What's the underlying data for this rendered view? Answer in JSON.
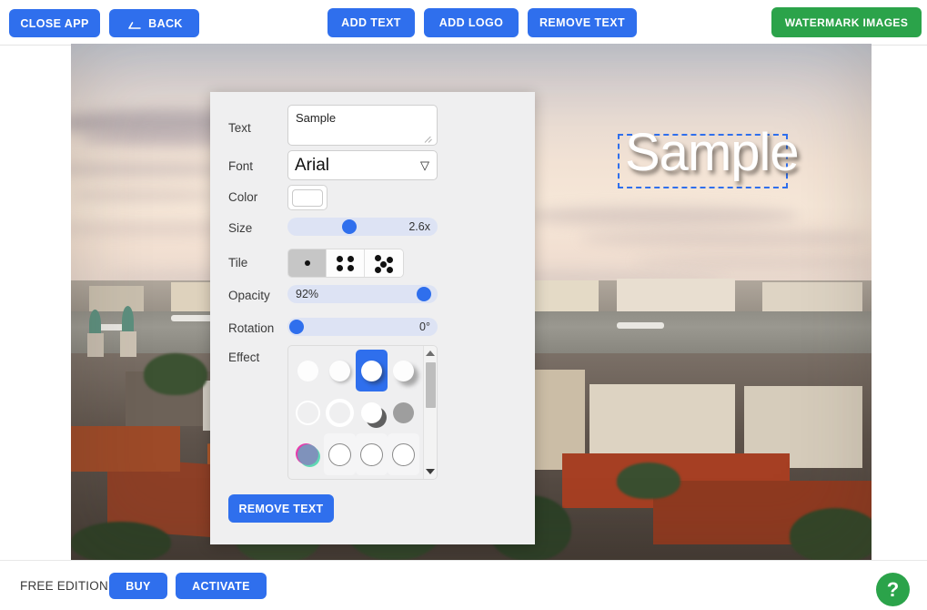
{
  "toolbar": {
    "close_app": "CLOSE APP",
    "back": "BACK",
    "back_icon": "arrow-left-icon",
    "add_text": "ADD TEXT",
    "add_logo": "ADD LOGO",
    "remove_text": "REMOVE TEXT",
    "watermark_images": "WATERMARK IMAGES",
    "blue": "#2f6fed",
    "green": "#2ba34a"
  },
  "canvas": {
    "watermark_text": "Sample",
    "selection_color": "#2f6fed"
  },
  "panel": {
    "text": {
      "label": "Text",
      "value": "Sample",
      "placeholder": ""
    },
    "font": {
      "label": "Font",
      "value": "Arial",
      "caret": "▽"
    },
    "color": {
      "label": "Color",
      "value": "#ffffff"
    },
    "size": {
      "label": "Size",
      "value": "2.6x",
      "percent": 28
    },
    "tile": {
      "label": "Tile",
      "options": [
        "tile-single",
        "tile-four",
        "tile-five"
      ],
      "selected_index": 0
    },
    "opacity": {
      "label": "Opacity",
      "value": "92%",
      "percent": 92
    },
    "rotation": {
      "label": "Rotation",
      "value": "0°",
      "percent": 0
    },
    "effect": {
      "label": "Effect",
      "selected_index": 2,
      "items": [
        {
          "name": "effect-plain",
          "style": "plain"
        },
        {
          "name": "effect-soft-shadow",
          "style": "soft-shadow"
        },
        {
          "name": "effect-drop-shadow",
          "style": "drop-shadow"
        },
        {
          "name": "effect-long-shadow",
          "style": "long-shadow"
        },
        {
          "name": "effect-thin-outline",
          "style": "thin-ring"
        },
        {
          "name": "effect-thick-outline",
          "style": "thick-ring"
        },
        {
          "name": "effect-hard-shadow",
          "style": "hard-shadow"
        },
        {
          "name": "effect-gray-fill",
          "style": "gray-fill"
        },
        {
          "name": "effect-chromatic",
          "style": "chromatic"
        },
        {
          "name": "effect-gray-outline-1",
          "style": "gray-outline"
        },
        {
          "name": "effect-gray-outline-2",
          "style": "gray-outline"
        },
        {
          "name": "effect-gray-outline-3",
          "style": "gray-outline"
        },
        {
          "name": "effect-block-gray-1",
          "style": "block-gray"
        },
        {
          "name": "effect-block-gray-2",
          "style": "block-gray"
        },
        {
          "name": "effect-block-gray-3",
          "style": "block-gray"
        },
        {
          "name": "effect-block-white",
          "style": "block-white"
        }
      ],
      "scrollbar": {
        "up": "▲",
        "down": "▼"
      }
    },
    "remove_text_button": "REMOVE TEXT"
  },
  "bottombar": {
    "edition": "FREE EDITION",
    "buy": "BUY",
    "activate": "ACTIVATE",
    "help": "?"
  }
}
